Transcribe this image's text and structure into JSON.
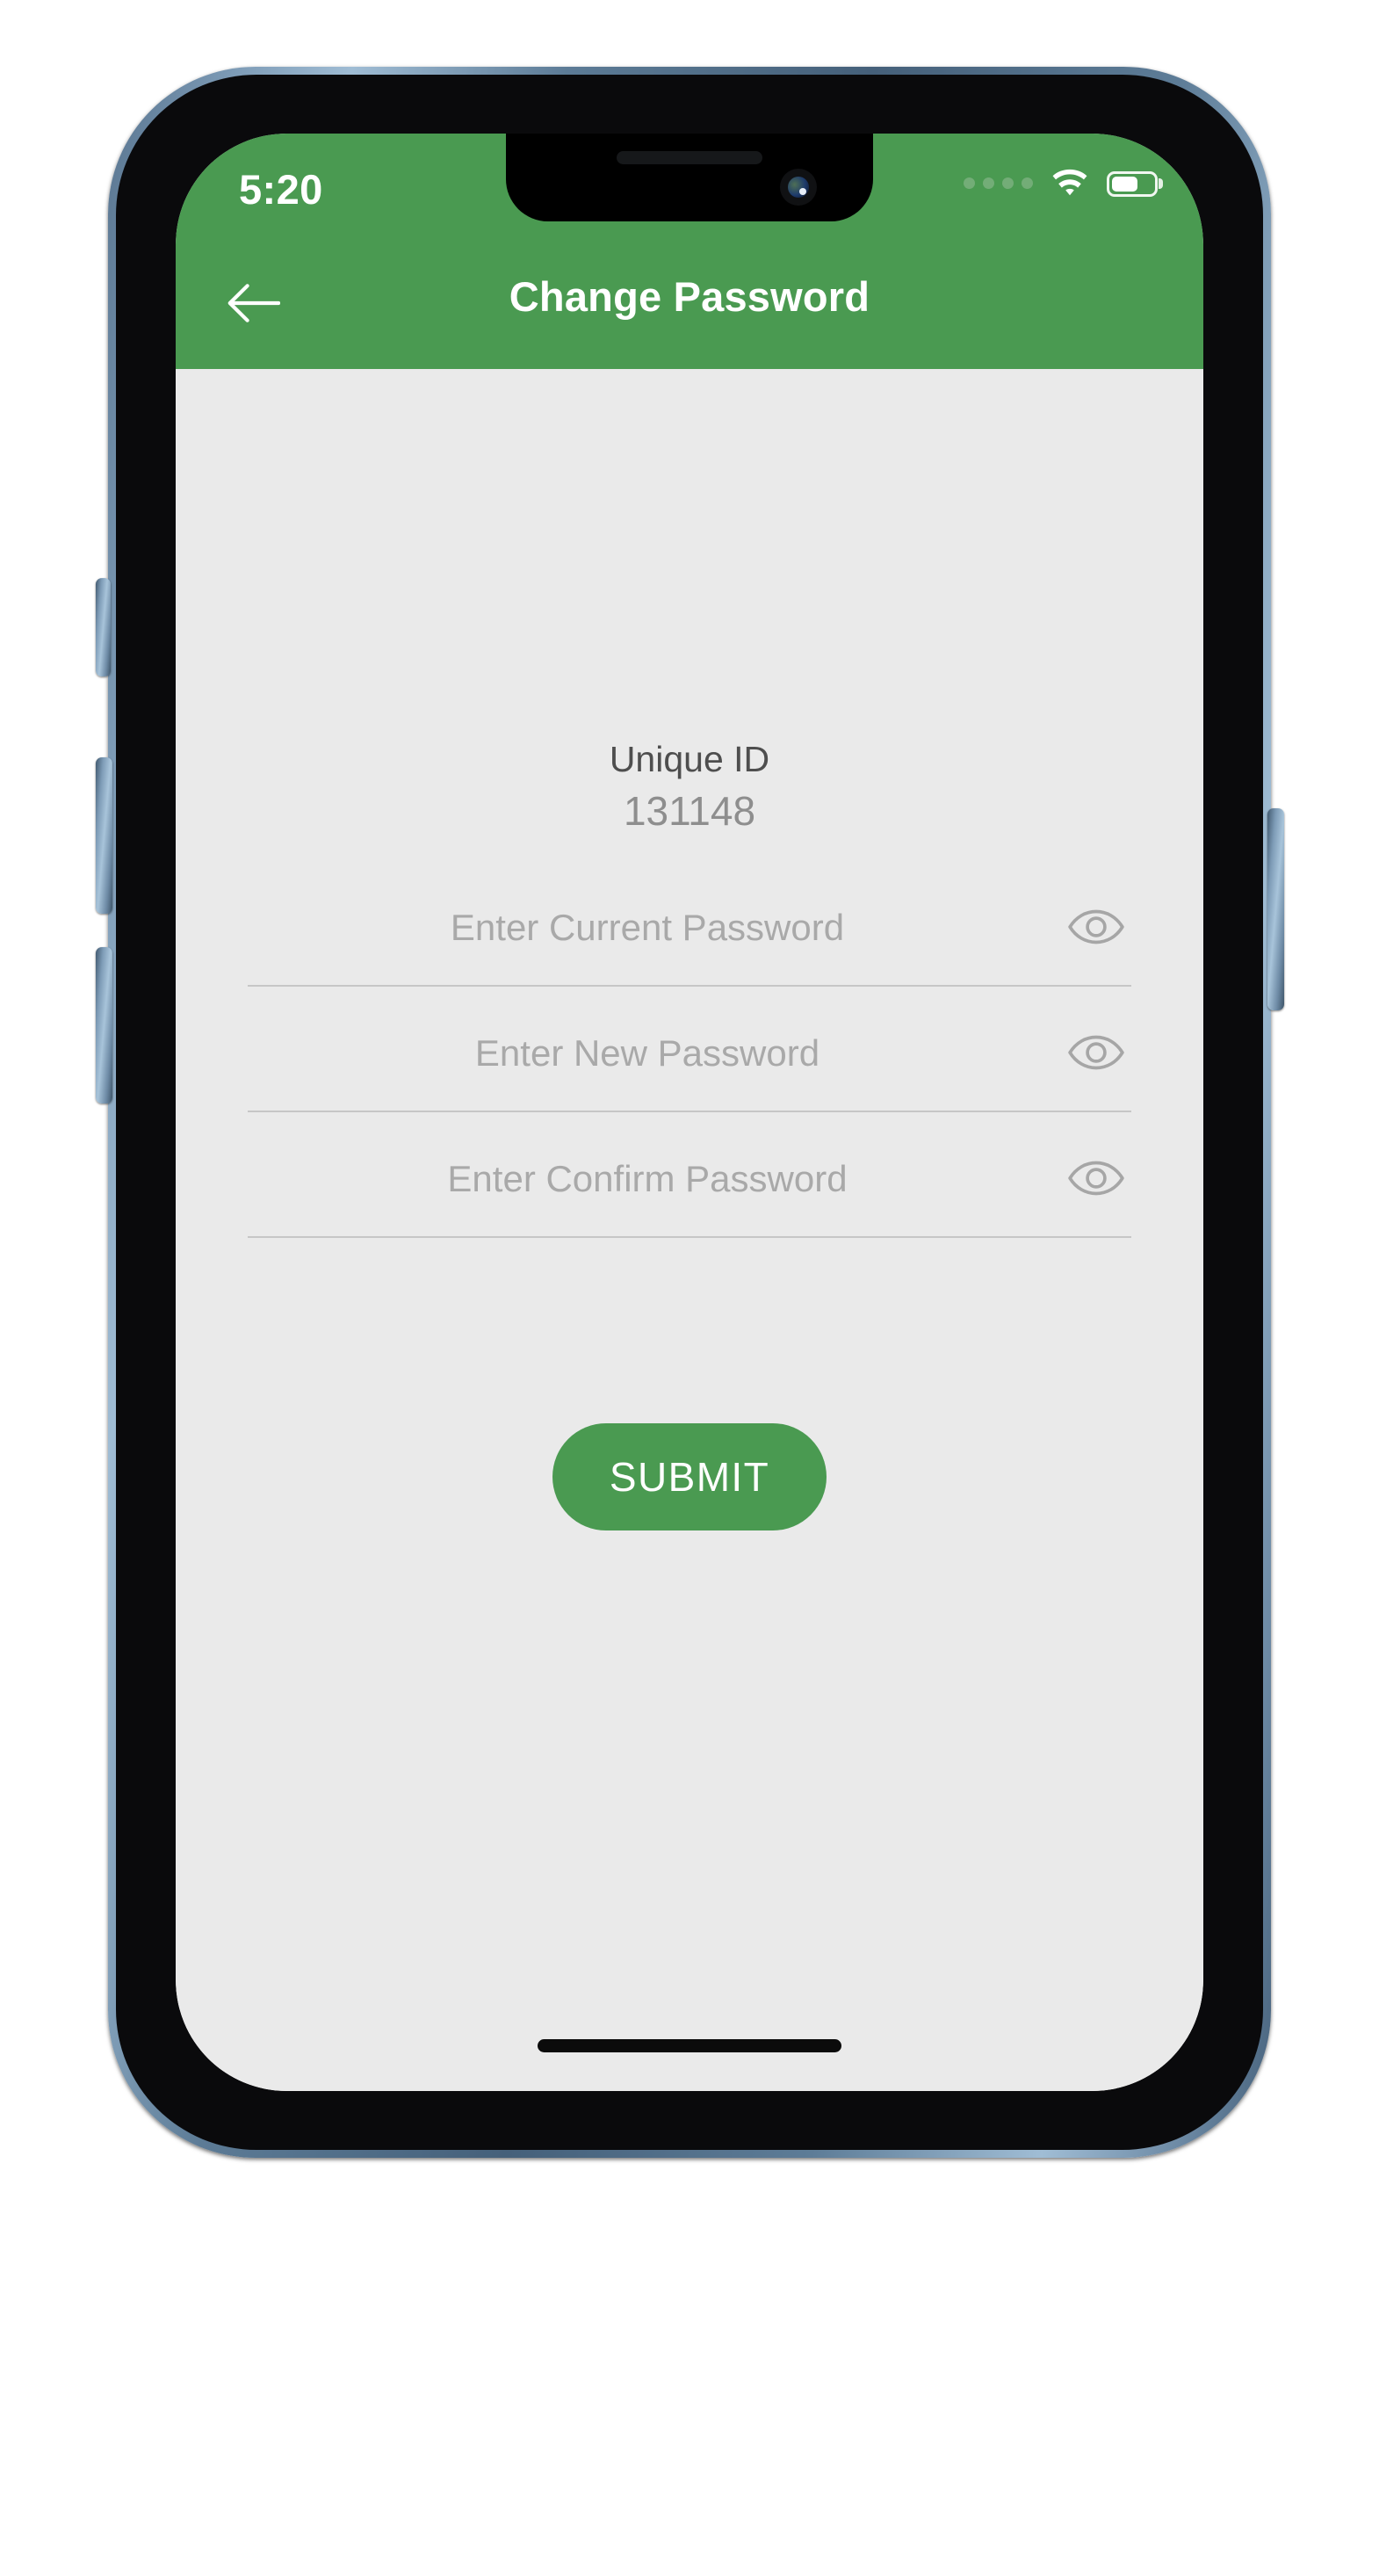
{
  "device": {
    "frame_color": "#5e7c97",
    "screen_background": "#eaeaea"
  },
  "status_bar": {
    "time": "5:20",
    "signal_dots": 4,
    "wifi_icon": "wifi-icon",
    "battery_icon": "battery-icon",
    "battery_level_percent": 56
  },
  "nav_bar": {
    "back_icon": "back-arrow-icon",
    "title": "Change Password",
    "background_color": "#4a9a51",
    "text_color": "#ffffff"
  },
  "content": {
    "unique_id_label": "Unique ID",
    "unique_id_value": "131148"
  },
  "form": {
    "fields": [
      {
        "name": "current-password",
        "placeholder": "Enter Current Password",
        "value": "",
        "toggle_icon": "eye-icon"
      },
      {
        "name": "new-password",
        "placeholder": "Enter New Password",
        "value": "",
        "toggle_icon": "eye-icon"
      },
      {
        "name": "confirm-password",
        "placeholder": "Enter Confirm Password",
        "value": "",
        "toggle_icon": "eye-icon"
      }
    ],
    "submit_label": "SUBMIT",
    "submit_color": "#4a9a51"
  },
  "home_indicator": "home-indicator"
}
